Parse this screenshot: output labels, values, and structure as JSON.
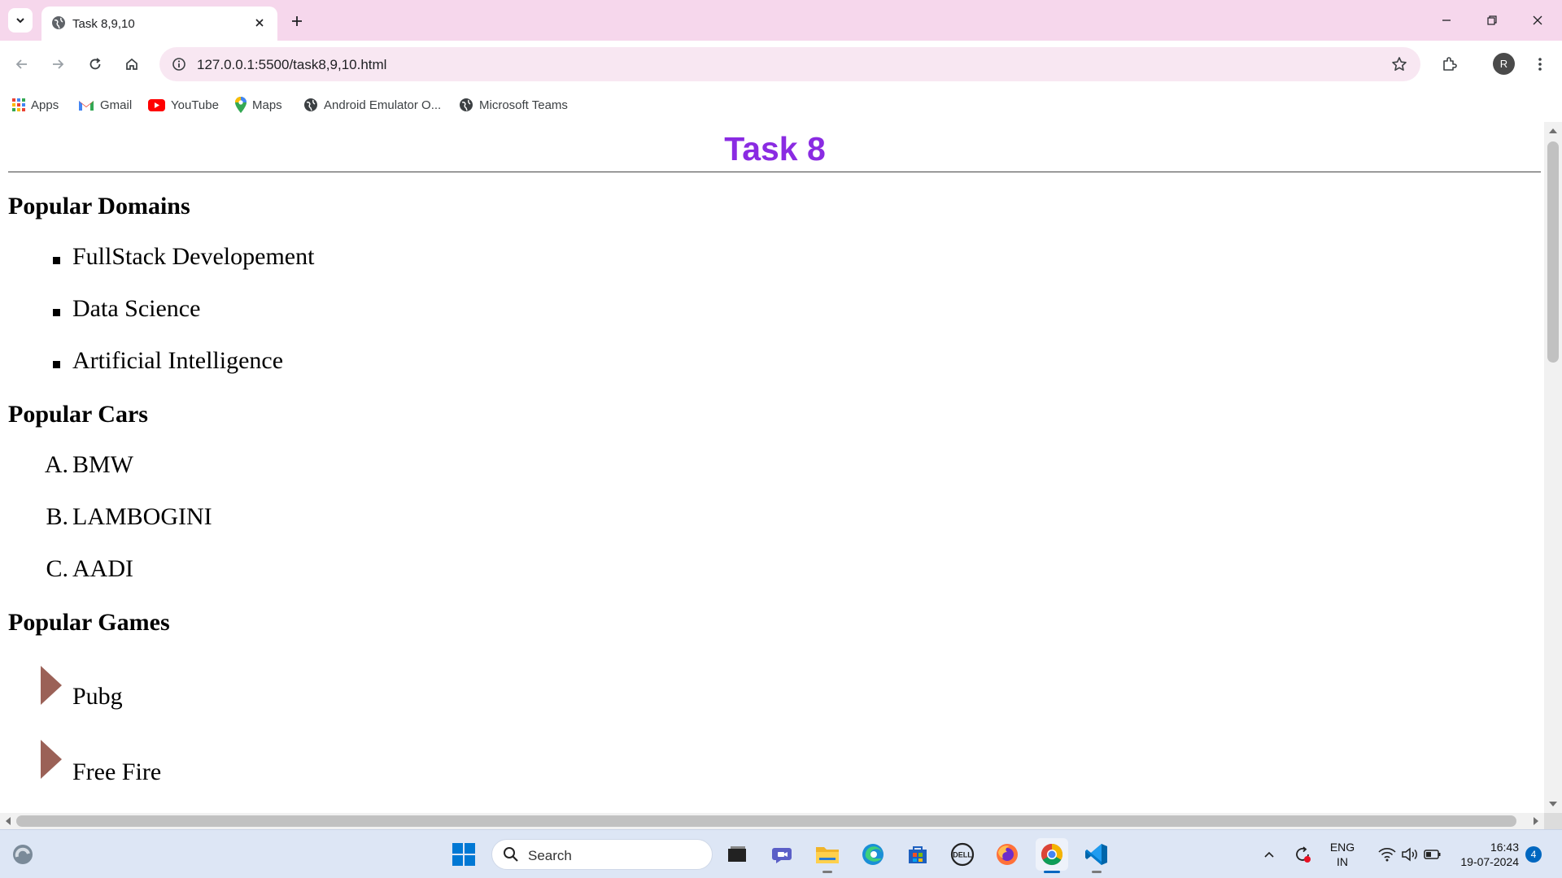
{
  "browser": {
    "tab": {
      "title": "Task 8,9,10"
    },
    "address": {
      "url": "127.0.0.1:5500/task8,9,10.html"
    },
    "profile_initial": "R",
    "bookmarks": [
      {
        "label": "Apps"
      },
      {
        "label": "Gmail"
      },
      {
        "label": "YouTube"
      },
      {
        "label": "Maps"
      },
      {
        "label": "Android Emulator O..."
      },
      {
        "label": "Microsoft Teams"
      }
    ]
  },
  "page": {
    "title": "Task 8",
    "title_color": "#8a2be2",
    "sections": [
      {
        "heading": "Popular Domains",
        "items": [
          "FullStack Developement",
          "Data Science",
          "Artificial Intelligence"
        ]
      },
      {
        "heading": "Popular Cars",
        "markers": [
          "A.",
          "B.",
          "C."
        ],
        "items": [
          "BMW",
          "LAMBOGINI",
          "AADI"
        ]
      },
      {
        "heading": "Popular Games",
        "items": [
          "Pubg",
          "Free Fire"
        ]
      }
    ],
    "game_marker_color": "#9b6157"
  },
  "taskbar": {
    "search_label": "Search",
    "language": {
      "line1": "ENG",
      "line2": "IN"
    },
    "clock": {
      "time": "16:43",
      "date": "19-07-2024"
    },
    "notification_count": "4"
  }
}
